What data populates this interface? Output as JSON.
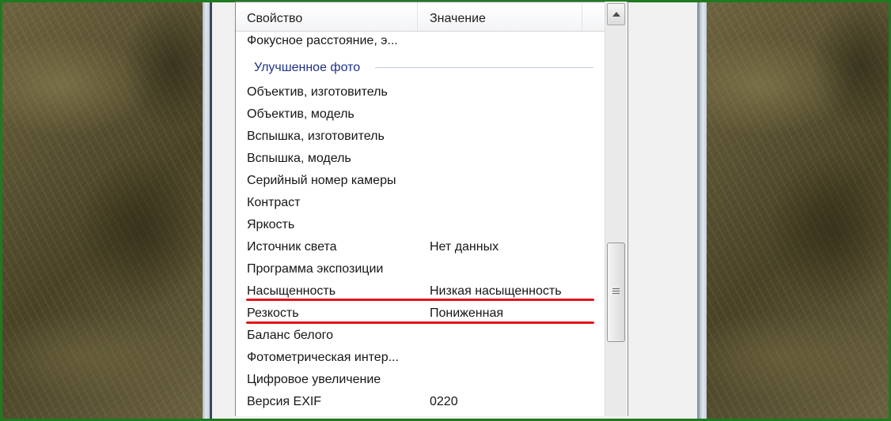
{
  "columns": {
    "property": "Свойство",
    "value": "Значение"
  },
  "rows_top": [
    {
      "property": "Фокусное расстояние, э...",
      "value": ""
    }
  ],
  "group_title": "Улучшенное фото",
  "rows": [
    {
      "property": "Объектив, изготовитель",
      "value": ""
    },
    {
      "property": "Объектив, модель",
      "value": ""
    },
    {
      "property": "Вспышка, изготовитель",
      "value": ""
    },
    {
      "property": "Вспышка, модель",
      "value": ""
    },
    {
      "property": "Серийный номер камеры",
      "value": ""
    },
    {
      "property": "Контраст",
      "value": ""
    },
    {
      "property": "Яркость",
      "value": ""
    },
    {
      "property": "Источник света",
      "value": "Нет данных"
    },
    {
      "property": "Программа экспозиции",
      "value": ""
    },
    {
      "property": "Насыщенность",
      "value": "Низкая насыщенность"
    },
    {
      "property": "Резкость",
      "value": "Пониженная"
    },
    {
      "property": "Баланс белого",
      "value": ""
    },
    {
      "property": "Фотометрическая интер...",
      "value": ""
    },
    {
      "property": "Цифровое увеличение",
      "value": ""
    },
    {
      "property": "Версия EXIF",
      "value": "0220"
    }
  ],
  "colors": {
    "outer_border": "#1f7a1f",
    "highlight_underline": "#e4141b",
    "group_title": "#1e3287"
  },
  "icons": {
    "scroll_up": "scroll-up-arrow-icon",
    "scroll_grip": "scroll-grip-icon"
  }
}
